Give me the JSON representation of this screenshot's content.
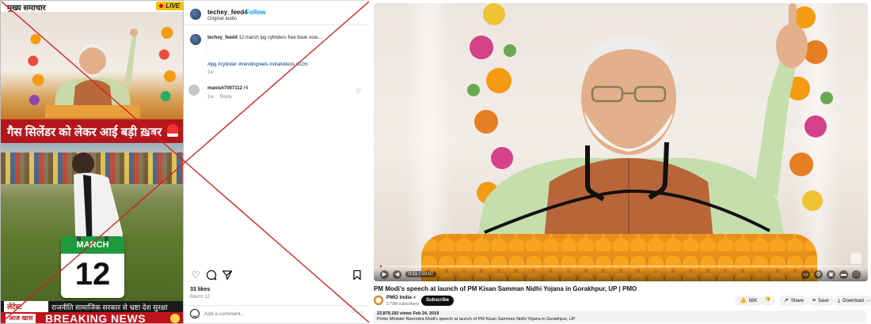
{
  "reel": {
    "channel_title": "मुख्य समाचार",
    "live_label": "LIVE",
    "headline": "गैस सिलेंडर को लेकर आई बड़ी ख़बर",
    "calendar_month": "MARCH",
    "calendar_day": "12",
    "ticker_badge": "लेटेस्ट",
    "ticker_text": "राजनीति सामाजिक सरकार से भ्रष्टा देश सुरक्षा",
    "breaking_badge": "आज खास",
    "breaking_text": "BREAKING NEWS"
  },
  "instagram": {
    "username": "techey_feed4",
    "follow_label": "Follow",
    "audio_label": "Original audio",
    "caption_user": "techey_feed4",
    "caption_text": "12 march lpg cylinders free book now....",
    "caption_dots": ".",
    "hashtags": "#lpg #cylinder #trendingreels #viralvideos #22m",
    "caption_time": "1w",
    "comment_user": "manish7007112",
    "comment_text": "Hi",
    "comment_time": "1w",
    "comment_reply": "Reply",
    "likes": "33 likes",
    "date": "March 12",
    "add_comment_placeholder": "Add a comment...",
    "post_label": "Post"
  },
  "youtube": {
    "title": "PM Modi's speech at launch of PM Kisan Samman Nidhi Yojana in Gorakhpur, UP | PMO",
    "channel": "PMO India",
    "subscribers": "2.79M subscribers",
    "subscribe_label": "Subscribe",
    "likes": "56K",
    "share_label": "Share",
    "save_label": "Save",
    "download_label": "Download",
    "more_label": "...",
    "time_display": "0:11 / 50:07",
    "views_date": "23,879,192 views  Feb 24, 2019",
    "description": "Prime Minister Narendra Modi's speech at launch of PM Kisan Samman Nidhi Yojana in Gorakhpur, UP",
    "progress_fraction": 0.004
  },
  "colors": {
    "cross": "#d81e1e",
    "headline_band": "#b5161c",
    "calendar_green": "#1e9a3e",
    "ig_link": "#0095f6",
    "yt_progress": "#ff0000"
  }
}
